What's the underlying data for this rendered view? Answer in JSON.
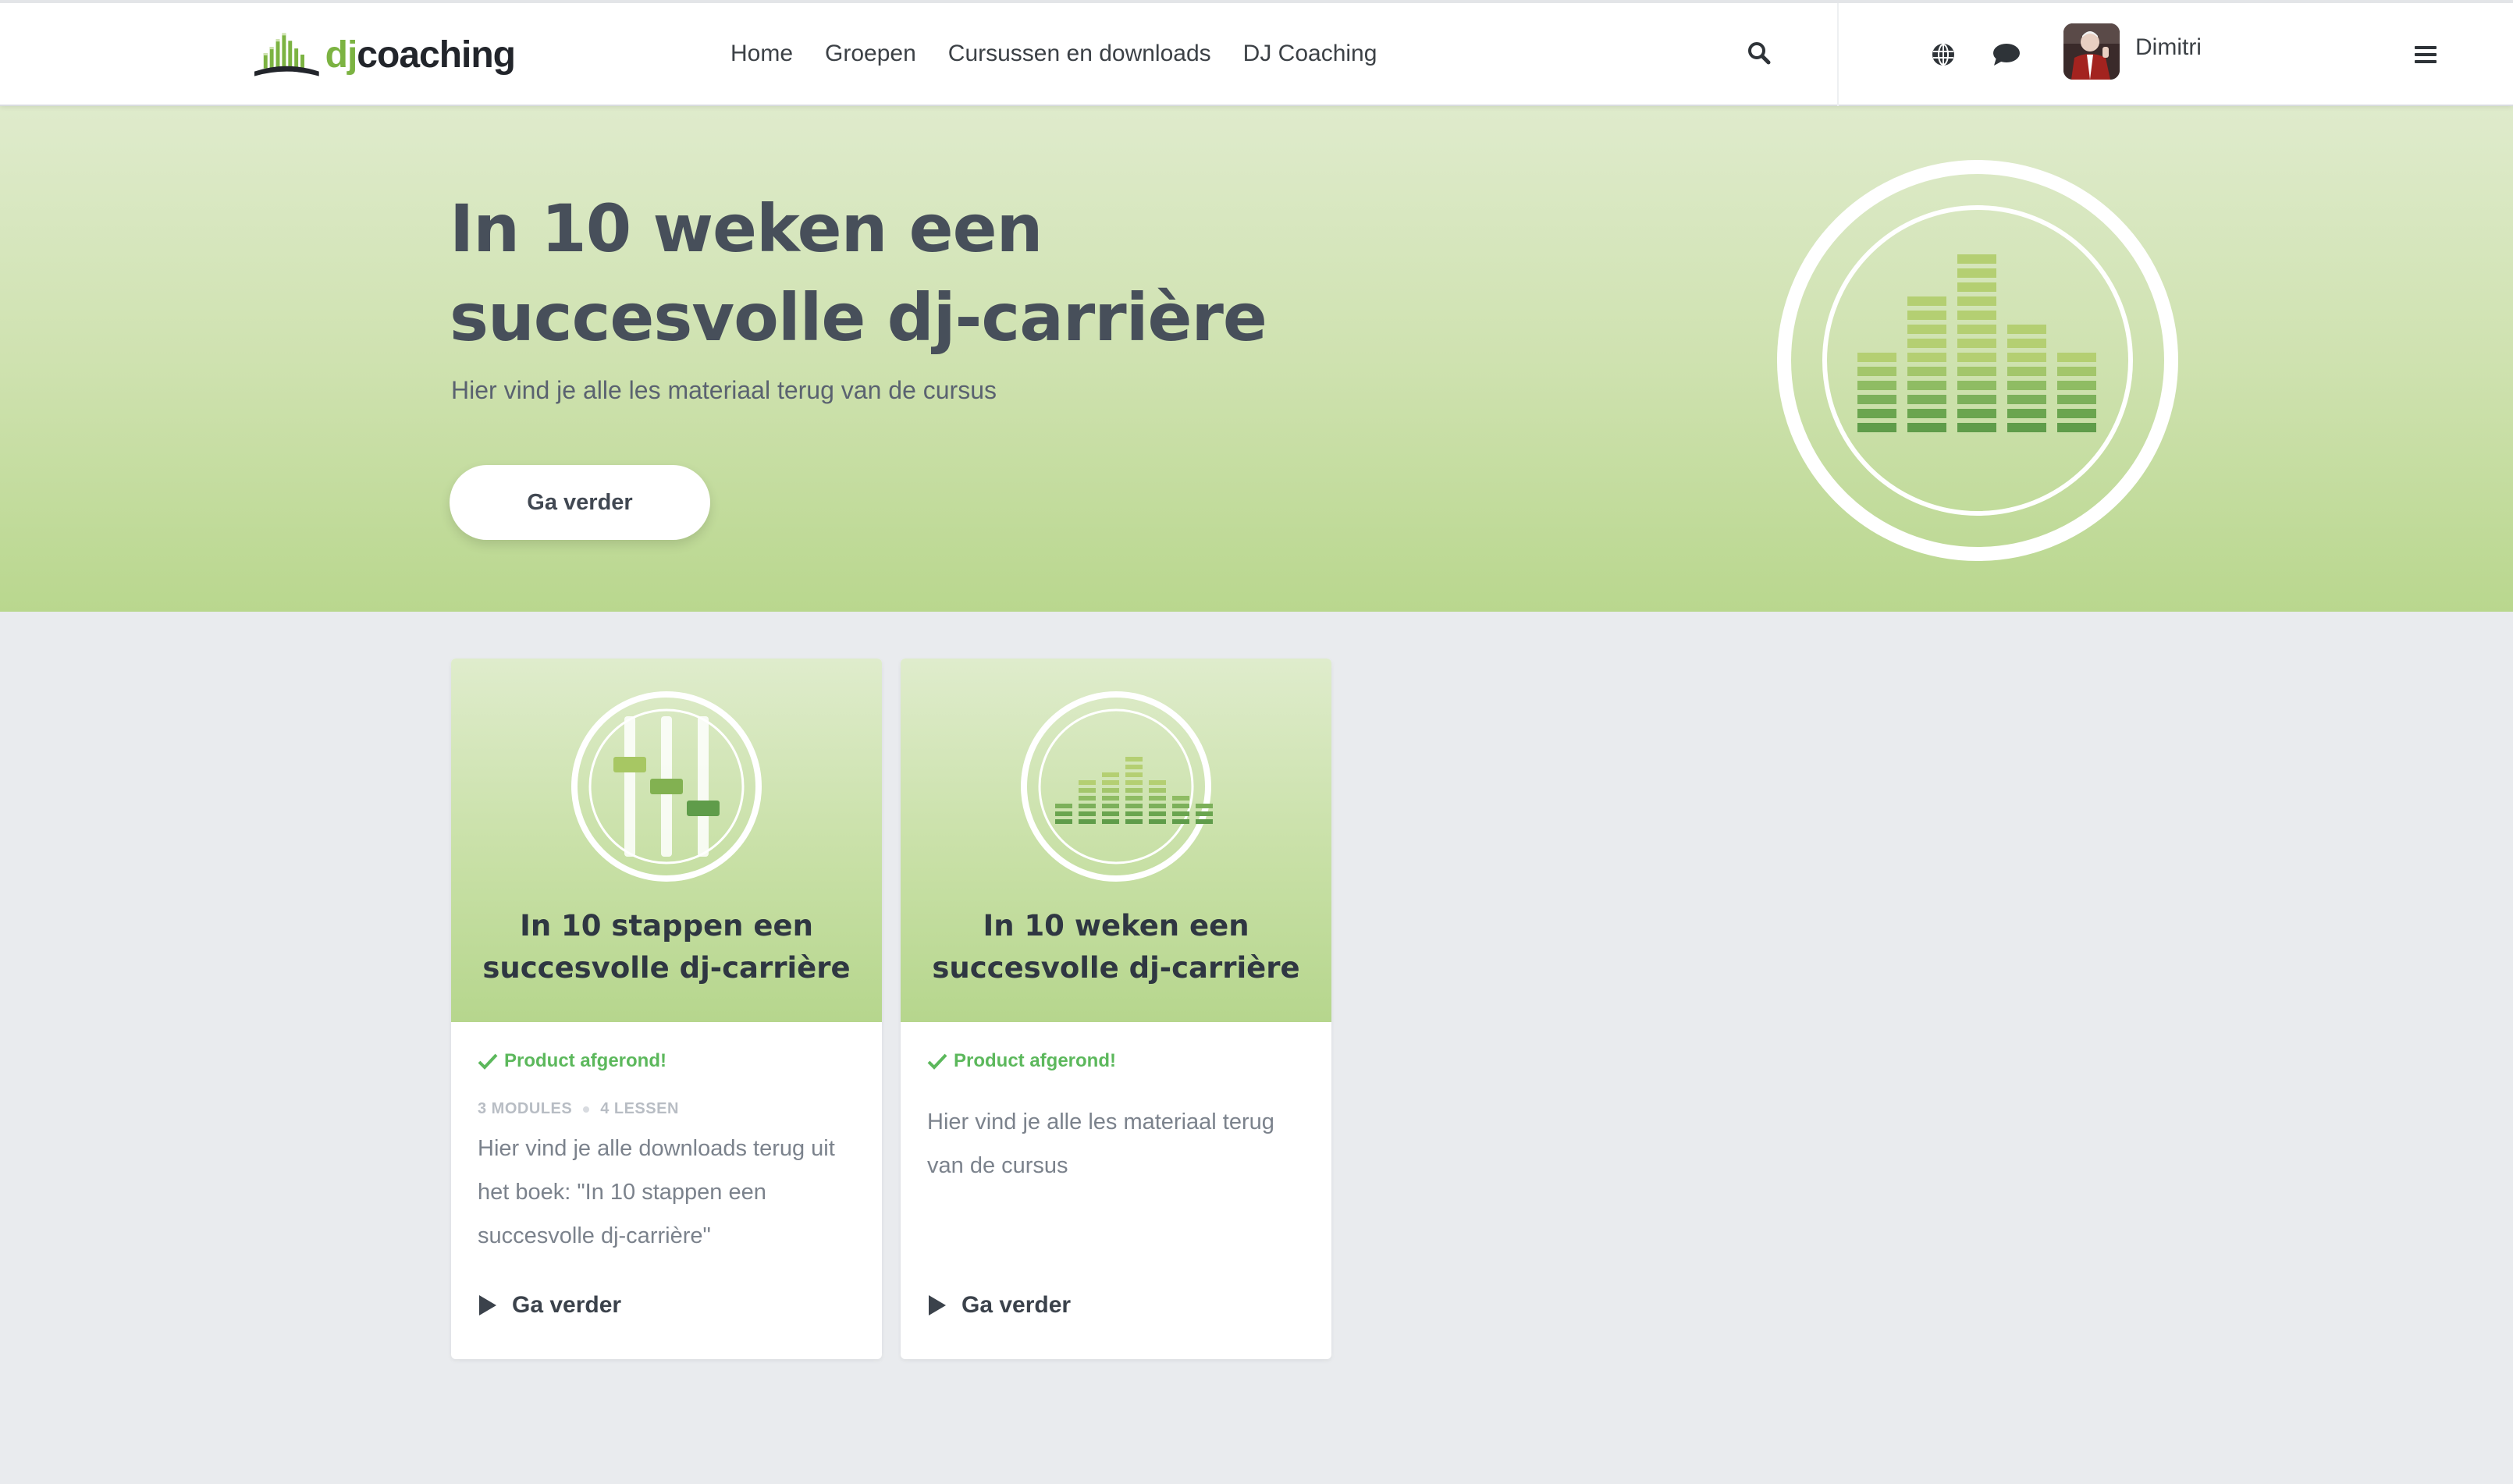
{
  "header": {
    "logo": {
      "text_dj": "dj",
      "text_rest": "coaching"
    },
    "nav": [
      {
        "label": "Home"
      },
      {
        "label": "Groepen"
      },
      {
        "label": "Cursussen en downloads"
      },
      {
        "label": "DJ Coaching"
      }
    ],
    "icons": [
      "search-icon",
      "globe-icon",
      "chat-icon",
      "menu-icon"
    ],
    "user": {
      "name": "Dimitri"
    }
  },
  "hero": {
    "title": "In 10 weken een succesvolle dj-carrière",
    "subtitle": "Hier vind je alle les materiaal terug van de cursus",
    "button_label": "Ga verder"
  },
  "cards": [
    {
      "title": "In 10 stappen een succesvolle dj-carrière",
      "status": "Product afgerond!",
      "modules": "3 MODULES",
      "lessons": "4 LESSEN",
      "description": "Hier vind je alle downloads terug uit het boek: \"In 10 stappen een succesvolle dj-carrière\"",
      "cta": "Ga verder",
      "art": "mixer-sliders"
    },
    {
      "title": "In 10 weken een succesvolle dj-carrière",
      "status": "Product afgerond!",
      "description": "Hier vind je alle les materiaal terug van de cursus",
      "cta": "Ga verder",
      "art": "equalizer-bars"
    }
  ],
  "colors": {
    "accent_green": "#7cb342",
    "status_green": "#5cb85c",
    "hero_gradient_top": "#dfebcc",
    "hero_gradient_bottom": "#b9d78e",
    "page_background": "#e9ebee",
    "heading_text": "#474f5a"
  }
}
